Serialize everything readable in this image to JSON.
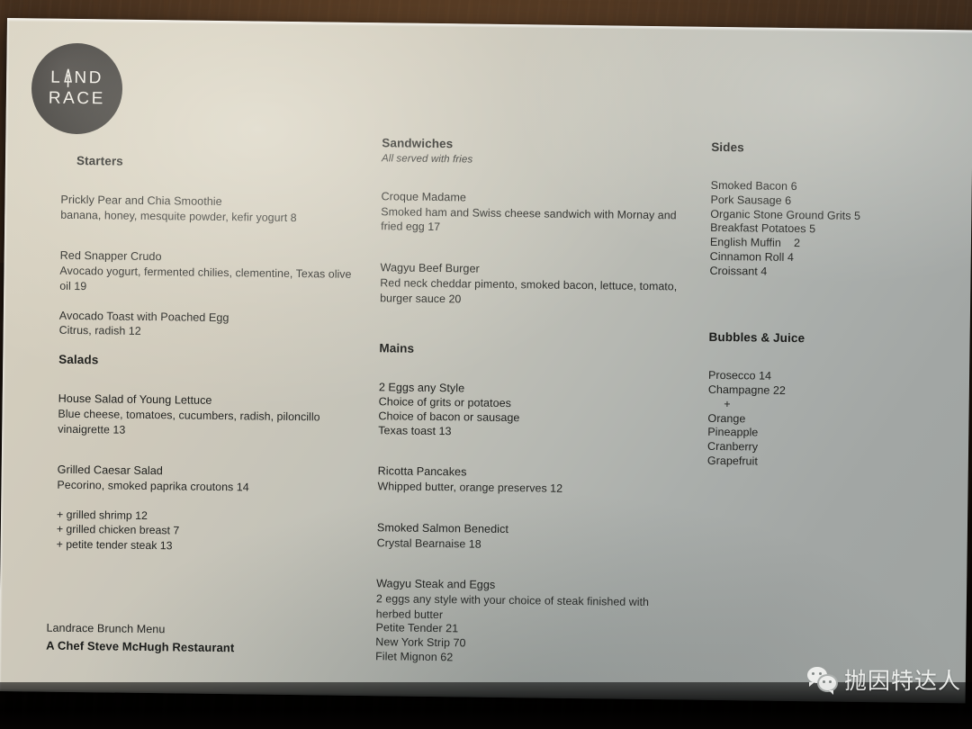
{
  "logo": {
    "line1": "LAND",
    "line2": "RACE",
    "icon": "fork-sprout-icon",
    "background_color": "#333130",
    "text_color": "#f2efe8"
  },
  "paper": {
    "color_light": "#d8d2c2",
    "color_dark": "#9da2a0"
  },
  "columns": {
    "left": [
      {
        "heading": "Starters",
        "heading_indented": true,
        "items": [
          {
            "name": "Prickly Pear and Chia Smoothie",
            "desc": "banana, honey, mesquite powder, kefir yogurt 8"
          },
          {
            "name": "Red Snapper Crudo",
            "desc": "Avocado yogurt, fermented chilies, clementine, Texas olive oil 19"
          },
          {
            "name": "Avocado Toast with Poached Egg",
            "desc": "Citrus, radish 12"
          }
        ]
      },
      {
        "heading": "Salads",
        "heading_indented": false,
        "items": [
          {
            "name": "House Salad of Young Lettuce",
            "desc": "Blue cheese, tomatoes, cucumbers, radish, piloncillo vinaigrette 13"
          },
          {
            "name": "Grilled Caesar Salad",
            "desc": "Pecorino, smoked paprika croutons 14"
          }
        ],
        "addons": [
          "+ grilled shrimp 12",
          "+ grilled chicken breast 7",
          "+ petite tender steak 13"
        ]
      }
    ],
    "middle": [
      {
        "heading": "Sandwiches",
        "subheading": "All served with fries",
        "items": [
          {
            "name": "Croque Madame",
            "desc": "Smoked ham and Swiss cheese sandwich with Mornay and fried egg 17"
          },
          {
            "name": "Wagyu Beef Burger",
            "desc": "Red neck cheddar pimento, smoked bacon, lettuce, tomato, burger sauce 20"
          }
        ]
      },
      {
        "heading": "Mains",
        "items": [
          {
            "name": "2 Eggs any Style",
            "lines": [
              "Choice of grits or potatoes",
              "Choice of bacon or sausage",
              "Texas toast 13"
            ]
          },
          {
            "name": "Ricotta Pancakes",
            "lines": [
              "Whipped butter, orange preserves 12"
            ]
          },
          {
            "name": "Smoked Salmon Benedict",
            "lines": [
              "Crystal Bearnaise 18"
            ]
          },
          {
            "name": "Wagyu Steak and Eggs",
            "lines": [
              "2 eggs any style with your choice of steak finished with herbed butter",
              "Petite Tender 21",
              "New York Strip 70",
              "Filet Mignon 62"
            ]
          }
        ]
      }
    ],
    "right": [
      {
        "heading": "Sides",
        "lines": [
          "Smoked Bacon 6",
          "Pork Sausage 6",
          "Organic Stone Ground Grits 5",
          "Breakfast Potatoes 5",
          "English Muffin    2",
          "Cinnamon Roll 4",
          "Croissant 4"
        ]
      },
      {
        "heading": "Bubbles & Juice",
        "lines": [
          "Prosecco 14",
          "Champagne 22",
          "     +",
          "Orange",
          "Pineapple",
          "Cranberry",
          "Grapefruit"
        ]
      }
    ]
  },
  "footer": {
    "line1": "Landrace Brunch Menu",
    "line2": "A Chef Steve McHugh Restaurant"
  },
  "watermark": {
    "text": "抛因特达人",
    "icon": "wechat-icon"
  }
}
